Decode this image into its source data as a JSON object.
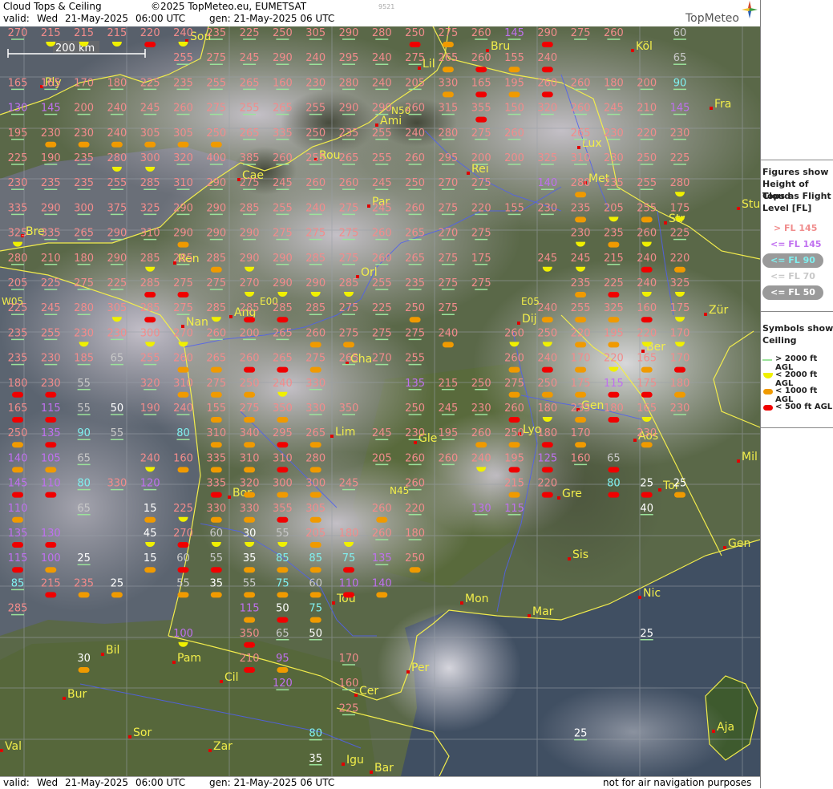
{
  "header": {
    "title": "Cloud Tops & Ceiling",
    "copyright": "©2025 TopMeteo.eu, EUMETSAT",
    "valid_label": "valid:",
    "valid_day": "Wed",
    "valid_date": "21-May-2025",
    "valid_time": "06:00 UTC",
    "gen_label": "gen: 21-May-2025 06 UTC",
    "small_code": "9521",
    "brand": "TopMeteo"
  },
  "footer": {
    "valid_label": "valid:",
    "valid_day": "Wed",
    "valid_date": "21-May-2025",
    "valid_time": "06:00 UTC",
    "gen_label": "gen: 21-May-2025 06 UTC",
    "disclaimer": "not for air navigation purposes"
  },
  "scale": {
    "label": "200 km"
  },
  "legend": {
    "figures_title": [
      "Figures show",
      "Height of Cloud",
      "Tops as Flight",
      "Level  [FL]"
    ],
    "levels": [
      {
        "label": "> FL 145",
        "color": "#f08c8c"
      },
      {
        "label": "<= FL 145",
        "color": "#c070f0"
      },
      {
        "label": "<= FL 90",
        "color": "#80f0f0"
      },
      {
        "label": "<= FL 70",
        "color": "#c8c8c8"
      },
      {
        "label": "<= FL 50",
        "color": "#ffffff"
      }
    ],
    "symbols_title": [
      "Symbols show",
      "Ceiling"
    ],
    "symbols": [
      {
        "label": "> 2000 ft AGL",
        "color": "#9be39b",
        "shape": "line"
      },
      {
        "label": "< 2000 ft AGL",
        "color": "#f0f000",
        "shape": "half-circle"
      },
      {
        "label": "< 1000 ft AGL",
        "color": "#f09a00",
        "shape": "pill"
      },
      {
        "label": "< 500 ft AGL",
        "color": "#f00000",
        "shape": "pill"
      }
    ]
  },
  "grid_labels": [
    "E00",
    "E05",
    "W05",
    "N45",
    "N50"
  ],
  "cities": [
    "Sou",
    "Bru",
    "Köl",
    "Lil",
    "Ply",
    "Ami",
    "Fra",
    "Lux",
    "Rou",
    "Rei",
    "Cae",
    "Met",
    "Par",
    "Stu",
    "Str",
    "Bre",
    "Ren",
    "Orl",
    "Nan",
    "Ang",
    "Dij",
    "Zür",
    "Ber",
    "Cha",
    "Gen",
    "Lim",
    "Lyo",
    "Gle",
    "Aos",
    "Mil",
    "Bor",
    "Gre",
    "Tor",
    "Gen",
    "Sis",
    "Tou",
    "Mon",
    "Nic",
    "Mar",
    "Bil",
    "Pam",
    "Cil",
    "Per",
    "Cer",
    "Bur",
    "Sor",
    "Val",
    "Zar",
    "Igu",
    "Bar",
    "Aja"
  ],
  "rows": [
    [
      "270",
      "215",
      "215",
      "215",
      "220",
      "240",
      "235",
      "225",
      "250",
      "305",
      "290",
      "280",
      "250",
      "275",
      "260",
      "145",
      "290",
      "275",
      "260",
      "",
      "60"
    ],
    [
      "",
      "",
      "",
      "",
      "",
      "255",
      "275",
      "245",
      "290",
      "240",
      "295",
      "240",
      "275",
      "265",
      "260",
      "155",
      "240",
      "",
      "",
      "",
      "65"
    ],
    [
      "165",
      "165",
      "170",
      "180",
      "225",
      "235",
      "255",
      "265",
      "160",
      "230",
      "280",
      "240",
      "205",
      "330",
      "165",
      "195",
      "260",
      "260",
      "180",
      "200",
      "90"
    ],
    [
      "130",
      "145",
      "200",
      "240",
      "245",
      "260",
      "275",
      "255",
      "265",
      "255",
      "290",
      "290",
      "260",
      "315",
      "355",
      "150",
      "320",
      "260",
      "245",
      "210",
      "145"
    ],
    [
      "195",
      "230",
      "230",
      "240",
      "305",
      "305",
      "250",
      "265",
      "335",
      "250",
      "235",
      "255",
      "240",
      "280",
      "275",
      "260",
      "",
      "265",
      "230",
      "220",
      "230"
    ],
    [
      "225",
      "190",
      "235",
      "280",
      "300",
      "320",
      "400",
      "385",
      "260",
      "255",
      "265",
      "255",
      "260",
      "295",
      "200",
      "200",
      "325",
      "310",
      "230",
      "250",
      "225"
    ],
    [
      "230",
      "235",
      "235",
      "255",
      "285",
      "310",
      "290",
      "275",
      "245",
      "260",
      "260",
      "245",
      "250",
      "270",
      "275",
      "",
      "140",
      "280",
      "235",
      "255",
      "280"
    ],
    [
      "335",
      "290",
      "300",
      "375",
      "325",
      "290",
      "290",
      "285",
      "255",
      "240",
      "275",
      "245",
      "260",
      "275",
      "220",
      "155",
      "230",
      "235",
      "205",
      "255",
      "175"
    ],
    [
      "325",
      "335",
      "265",
      "290",
      "310",
      "290",
      "290",
      "290",
      "275",
      "275",
      "275",
      "260",
      "265",
      "270",
      "275",
      "",
      "",
      "230",
      "235",
      "260",
      "225"
    ],
    [
      "280",
      "210",
      "180",
      "290",
      "285",
      "285",
      "285",
      "290",
      "290",
      "285",
      "275",
      "260",
      "265",
      "275",
      "175",
      "",
      "245",
      "245",
      "215",
      "240",
      "220"
    ],
    [
      "205",
      "225",
      "275",
      "225",
      "285",
      "275",
      "275",
      "270",
      "290",
      "290",
      "285",
      "255",
      "235",
      "275",
      "275",
      "",
      "",
      "235",
      "225",
      "240",
      "325"
    ],
    [
      "225",
      "245",
      "280",
      "305",
      "285",
      "275",
      "285",
      "285",
      "285",
      "285",
      "275",
      "225",
      "250",
      "275",
      "",
      "",
      "240",
      "255",
      "325",
      "160",
      "175"
    ],
    [
      "235",
      "255",
      "230",
      "230",
      "300",
      "270",
      "260",
      "200",
      "265",
      "260",
      "275",
      "275",
      "275",
      "240",
      "",
      "260",
      "250",
      "220",
      "195",
      "220",
      "170"
    ],
    [
      "235",
      "230",
      "185",
      "65",
      "255",
      "260",
      "265",
      "260",
      "265",
      "275",
      "265",
      "270",
      "255",
      "",
      "",
      "260",
      "240",
      "170",
      "220",
      "165",
      "170"
    ],
    [
      "180",
      "230",
      "55",
      "",
      "320",
      "310",
      "275",
      "250",
      "240",
      "330",
      "",
      "",
      "135",
      "215",
      "250",
      "275",
      "250",
      "175",
      "115",
      "175",
      "180"
    ],
    [
      "165",
      "115",
      "55",
      "50",
      "190",
      "240",
      "155",
      "275",
      "350",
      "330",
      "350",
      "",
      "250",
      "245",
      "230",
      "260",
      "180",
      "235",
      "180",
      "165",
      "230"
    ],
    [
      "250",
      "135",
      "90",
      "55",
      "",
      "80",
      "310",
      "340",
      "295",
      "265",
      "",
      "245",
      "230",
      "195",
      "260",
      "250",
      "180",
      "170",
      "",
      "230",
      ""
    ],
    [
      "140",
      "105",
      "65",
      "",
      "240",
      "160",
      "335",
      "310",
      "310",
      "280",
      "",
      "205",
      "260",
      "260",
      "240",
      "195",
      "125",
      "160",
      "65",
      "",
      ""
    ],
    [
      "145",
      "110",
      "80",
      "330",
      "120",
      "",
      "335",
      "320",
      "300",
      "300",
      "245",
      "",
      "260",
      "",
      "",
      "215",
      "220",
      "",
      "80",
      "25",
      "25"
    ],
    [
      "110",
      "",
      "65",
      "",
      "15",
      "225",
      "330",
      "330",
      "355",
      "305",
      "",
      "260",
      "220",
      "",
      "130",
      "115",
      "",
      "",
      "",
      "40",
      ""
    ],
    [
      "135",
      "130",
      "",
      "",
      "45",
      "270",
      "60",
      "30",
      "55",
      "205",
      "180",
      "260",
      "180",
      "",
      "",
      "",
      "",
      "",
      "",
      "",
      ""
    ],
    [
      "115",
      "100",
      "25",
      "",
      "15",
      "60",
      "55",
      "35",
      "85",
      "85",
      "75",
      "135",
      "250",
      "",
      "",
      "",
      "",
      "",
      "",
      "",
      ""
    ],
    [
      "85",
      "215",
      "235",
      "25",
      "",
      "55",
      "35",
      "55",
      "75",
      "60",
      "110",
      "140",
      "",
      "",
      "",
      "",
      "",
      "",
      "",
      "",
      ""
    ],
    [
      "285",
      "",
      "",
      "",
      "",
      "",
      "",
      "115",
      "50",
      "75",
      "",
      "",
      "",
      "",
      "",
      "",
      "",
      "",
      "",
      "",
      ""
    ],
    [
      "",
      "",
      "",
      "",
      "",
      "100",
      "",
      "350",
      "65",
      "50",
      "",
      "",
      "",
      "",
      "",
      "",
      "",
      "",
      "",
      "25",
      ""
    ],
    [
      "",
      "",
      "30",
      "",
      "",
      "",
      "",
      "210",
      "95",
      "",
      "170",
      "",
      "",
      "",
      "",
      "",
      "",
      "",
      "",
      "",
      ""
    ],
    [
      "",
      "",
      "",
      "",
      "",
      "",
      "",
      "",
      "120",
      "",
      "160",
      "",
      "",
      "",
      "",
      "",
      "",
      "",
      "",
      "",
      ""
    ],
    [
      "",
      "",
      "",
      "",
      "",
      "",
      "",
      "",
      "",
      "",
      "225",
      "",
      "",
      "",
      "",
      "",
      "",
      "",
      "",
      "",
      ""
    ],
    [
      "",
      "",
      "",
      "",
      "",
      "",
      "",
      "",
      "",
      "80",
      "",
      "",
      "",
      "",
      "",
      "",
      "",
      "25",
      "",
      "",
      ""
    ],
    [
      "",
      "",
      "",
      "",
      "",
      "",
      "",
      "",
      "",
      "35",
      "",
      "",
      "",
      "",
      "",
      "",
      "",
      "",
      "",
      "",
      ""
    ]
  ],
  "ceilings": [
    [
      "g",
      "y",
      "y",
      "y",
      "r",
      "y",
      "g",
      "g",
      "g",
      "g",
      "g",
      "g",
      "r",
      "o",
      "g",
      "g",
      "r",
      "g",
      "g",
      "",
      "g"
    ],
    [
      "",
      "r",
      "",
      "",
      "",
      "g",
      "g",
      "g",
      "g",
      "g",
      "g",
      "g",
      "g",
      "o",
      "r",
      "o",
      "r",
      "",
      "",
      "",
      "g"
    ],
    [
      "g",
      "g",
      "g",
      "g",
      "g",
      "g",
      "g",
      "g",
      "g",
      "g",
      "g",
      "g",
      "g",
      "o",
      "r",
      "o",
      "r",
      "g",
      "g",
      "g",
      "g"
    ],
    [
      "g",
      "g",
      "g",
      "g",
      "g",
      "g",
      "g",
      "g",
      "g",
      "g",
      "g",
      "g",
      "g",
      "g",
      "r",
      "g",
      "g",
      "g",
      "g",
      "g",
      "g"
    ],
    [
      "g",
      "o",
      "o",
      "o",
      "o",
      "o",
      "o",
      "g",
      "g",
      "g",
      "g",
      "g",
      "g",
      "g",
      "g",
      "",
      "",
      "g",
      "g",
      "g",
      "g"
    ],
    [
      "g",
      "g",
      "g",
      "y",
      "y",
      "g",
      "g",
      "g",
      "g",
      "g",
      "g",
      "g",
      "g",
      "g",
      "g",
      "g",
      "g",
      "g",
      "g",
      "g",
      "g"
    ],
    [
      "g",
      "g",
      "g",
      "g",
      "g",
      "g",
      "g",
      "g",
      "g",
      "g",
      "g",
      "g",
      "g",
      "g",
      "g",
      "",
      "g",
      "o",
      "g",
      "g",
      "y"
    ],
    [
      "g",
      "g",
      "g",
      "g",
      "g",
      "g",
      "g",
      "g",
      "g",
      "g",
      "g",
      "g",
      "g",
      "g",
      "g",
      "g",
      "g",
      "o",
      "y",
      "o",
      "y"
    ],
    [
      "y",
      "g",
      "g",
      "g",
      "g",
      "o",
      "g",
      "g",
      "g",
      "g",
      "g",
      "g",
      "g",
      "g",
      "g",
      "",
      "",
      "y",
      "o",
      "y",
      "g"
    ],
    [
      "g",
      "g",
      "g",
      "g",
      "y",
      "g",
      "o",
      "y",
      "g",
      "g",
      "g",
      "g",
      "g",
      "g",
      "g",
      "",
      "y",
      "y",
      "g",
      "r",
      "o"
    ],
    [
      "g",
      "g",
      "g",
      "g",
      "r",
      "r",
      "g",
      "y",
      "y",
      "y",
      "y",
      "g",
      "g",
      "g",
      "g",
      "",
      "",
      "o",
      "r",
      "y",
      "y"
    ],
    [
      "g",
      "g",
      "g",
      "y",
      "r",
      "g",
      "y",
      "r",
      "r",
      "g",
      "g",
      "g",
      "o",
      "g",
      "",
      "",
      "o",
      "o",
      "o",
      "r",
      "y"
    ],
    [
      "g",
      "g",
      "y",
      "g",
      "y",
      "y",
      "g",
      "g",
      "g",
      "o",
      "o",
      "g",
      "g",
      "o",
      "",
      "y",
      "y",
      "o",
      "o",
      "y",
      "y"
    ],
    [
      "g",
      "g",
      "g",
      "g",
      "g",
      "o",
      "o",
      "r",
      "r",
      "o",
      "g",
      "g",
      "g",
      "",
      "",
      "o",
      "r",
      "o",
      "y",
      "o",
      "r"
    ],
    [
      "r",
      "r",
      "g",
      "",
      "g",
      "o",
      "o",
      "o",
      "y",
      "g",
      "",
      "",
      "g",
      "g",
      "g",
      "o",
      "o",
      "o",
      "r",
      "r",
      "o"
    ],
    [
      "r",
      "r",
      "g",
      "g",
      "g",
      "g",
      "o",
      "o",
      "o",
      "g",
      "g",
      "",
      "g",
      "g",
      "g",
      "r",
      "y",
      "o",
      "r",
      "y",
      "g"
    ],
    [
      "o",
      "r",
      "g",
      "g",
      "",
      "g",
      "o",
      "o",
      "r",
      "o",
      "",
      "g",
      "g",
      "g",
      "o",
      "o",
      "r",
      "o",
      "",
      "o",
      ""
    ],
    [
      "o",
      "o",
      "g",
      "",
      "y",
      "o",
      "o",
      "o",
      "r",
      "o",
      "",
      "g",
      "g",
      "g",
      "y",
      "r",
      "r",
      "g",
      "r",
      "",
      ""
    ],
    [
      "r",
      "r",
      "g",
      "g",
      "g",
      "",
      "r",
      "o",
      "o",
      "o",
      "g",
      "",
      "g",
      "",
      "",
      "o",
      "r",
      "",
      "r",
      "r",
      "o"
    ],
    [
      "o",
      "",
      "g",
      "",
      "o",
      "y",
      "o",
      "o",
      "r",
      "o",
      "",
      "o",
      "g",
      "",
      "g",
      "g",
      "",
      "",
      "",
      "g",
      ""
    ],
    [
      "r",
      "r",
      "",
      "",
      "y",
      "r",
      "y",
      "y",
      "y",
      "o",
      "y",
      "g",
      "g",
      "",
      "",
      "",
      "",
      "",
      "",
      "",
      ""
    ],
    [
      "r",
      "o",
      "g",
      "",
      "o",
      "r",
      "r",
      "o",
      "o",
      "o",
      "r",
      "g",
      "o",
      "",
      "",
      "",
      "",
      "",
      "",
      "",
      ""
    ],
    [
      "g",
      "r",
      "o",
      "o",
      "",
      "o",
      "o",
      "o",
      "o",
      "o",
      "r",
      "o",
      "",
      "",
      "",
      "",
      "",
      "",
      "",
      "",
      ""
    ],
    [
      "g",
      "",
      "",
      "",
      "",
      "",
      "",
      "o",
      "r",
      "o",
      "",
      "",
      "",
      "",
      "",
      "",
      "",
      "",
      "",
      "",
      ""
    ],
    [
      "",
      "",
      "",
      "",
      "",
      "y",
      "",
      "r",
      "g",
      "g",
      "",
      "",
      "",
      "",
      "",
      "",
      "",
      "",
      "",
      "g",
      ""
    ],
    [
      "",
      "",
      "o",
      "",
      "",
      "",
      "",
      "r",
      "o",
      "",
      "g",
      "",
      "",
      "",
      "",
      "",
      "",
      "",
      "",
      "",
      ""
    ],
    [
      "",
      "",
      "",
      "",
      "",
      "",
      "",
      "",
      "g",
      "",
      "g",
      "",
      "",
      "",
      "",
      "",
      "",
      "",
      "",
      "",
      ""
    ],
    [
      "",
      "",
      "",
      "",
      "",
      "",
      "",
      "",
      "",
      "",
      "g",
      "",
      "",
      "",
      "",
      "",
      "",
      "",
      "",
      "",
      ""
    ],
    [
      "",
      "",
      "",
      "",
      "",
      "",
      "",
      "",
      "",
      "g",
      "",
      "",
      "",
      "",
      "",
      "",
      "",
      "",
      "",
      "",
      ""
    ],
    [
      "",
      "",
      "",
      "",
      "",
      "",
      "",
      "",
      "",
      "g",
      "",
      "",
      "",
      "",
      "",
      "",
      "",
      "",
      "",
      "",
      ""
    ]
  ]
}
